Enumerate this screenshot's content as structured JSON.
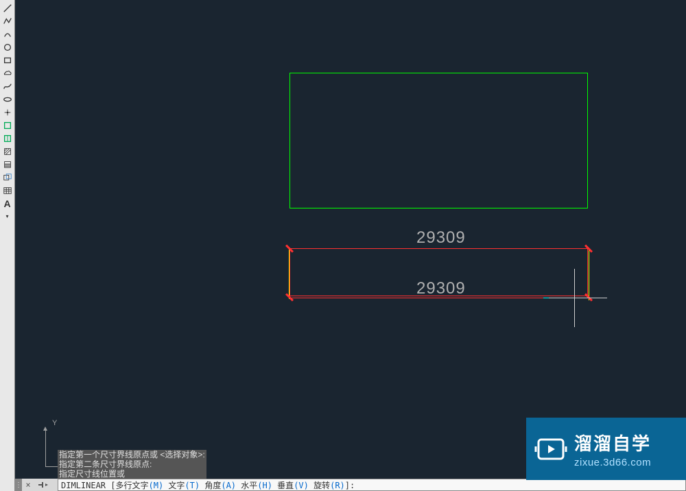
{
  "toolbar": {
    "tools": [
      "line",
      "polyline",
      "circle",
      "arc",
      "rectangle",
      "polygon",
      "spline",
      "ellipse",
      "elliptical-arc",
      "cloud",
      "point",
      "hatch",
      "gradient",
      "move",
      "copy",
      "region",
      "table",
      "text"
    ]
  },
  "canvas": {
    "dimension1": "29309",
    "dimension2": "29309",
    "ucs_y_label": "Y"
  },
  "command_history": {
    "line1": "指定第一个尺寸界线原点或 <选择对象>:",
    "line2": "指定第二条尺寸界线原点:",
    "line3": "指定尺寸线位置或"
  },
  "command_prompt": {
    "command": "DIMLINEAR",
    "prefix": " [",
    "opt1_text": "多行文字",
    "opt1_key": "(M)",
    "opt2_text": " 文字",
    "opt2_key": "(T)",
    "opt3_text": " 角度",
    "opt3_key": "(A)",
    "opt4_text": " 水平",
    "opt4_key": "(H)",
    "opt5_text": " 垂直",
    "opt5_key": "(V)",
    "opt6_text": " 旋转",
    "opt6_key": "(R)",
    "suffix": "]:",
    "close": "×"
  },
  "watermark": {
    "brand": "溜溜自学",
    "url": "zixue.3d66.com"
  }
}
